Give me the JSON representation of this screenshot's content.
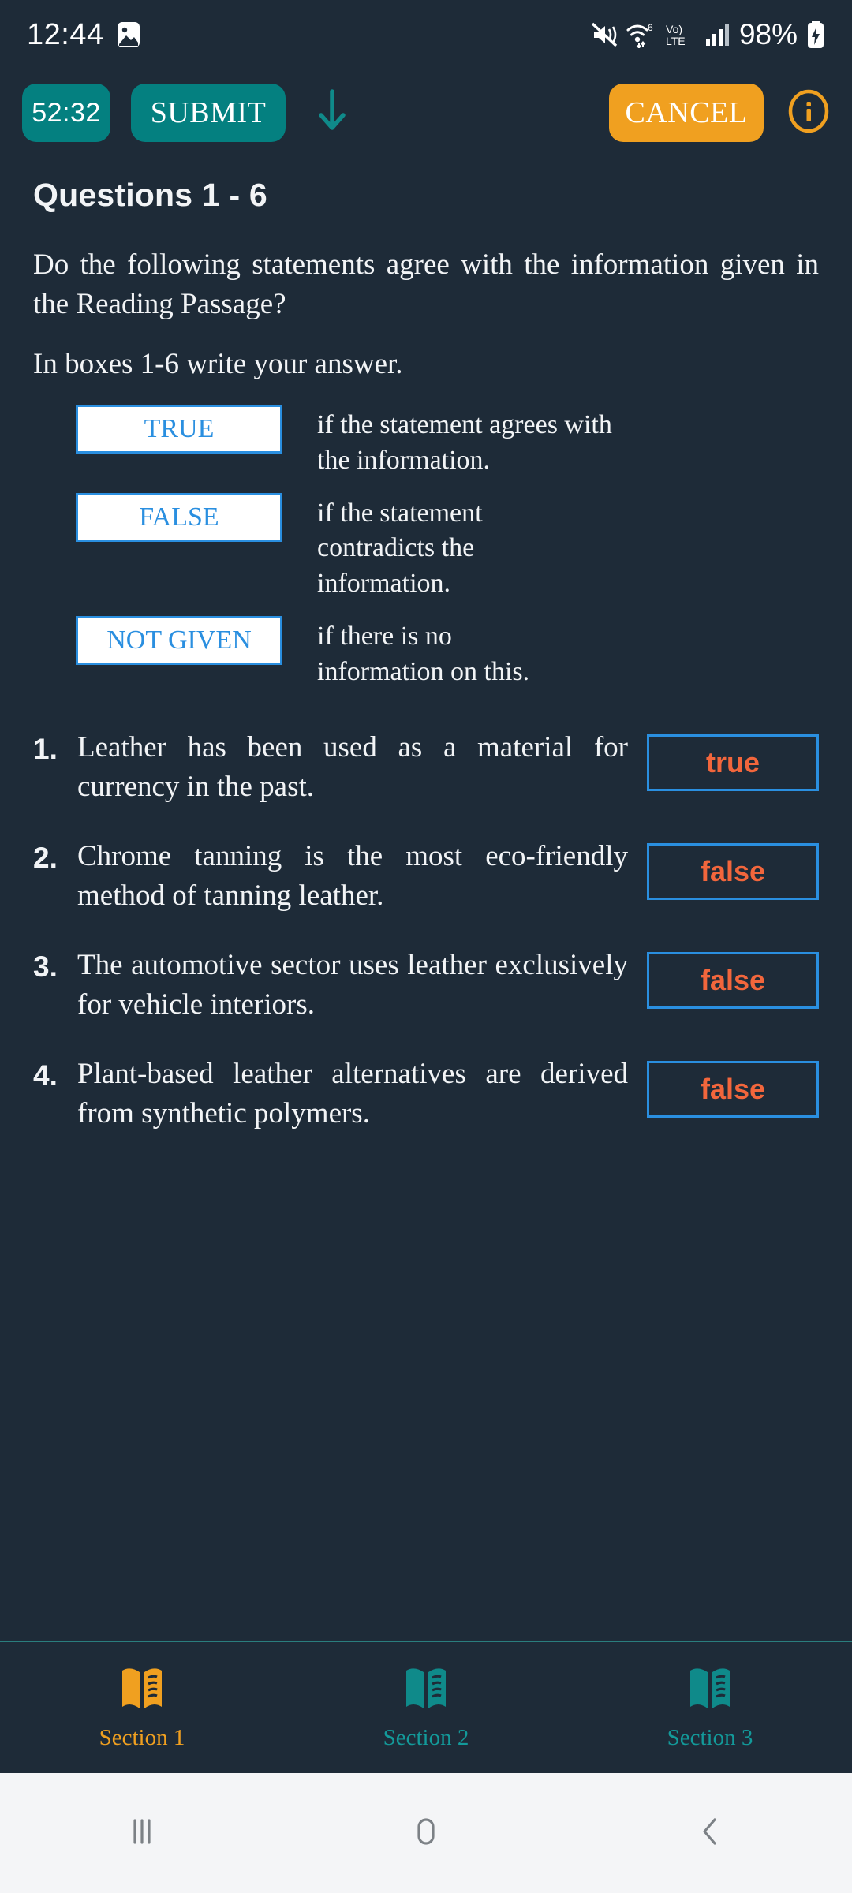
{
  "statusbar": {
    "time": "12:44",
    "battery_percent": "98%",
    "icons": [
      "image-icon",
      "mute-icon",
      "wifi6-icon",
      "volte-lte-icon",
      "signal-bars-icon",
      "battery-charging-icon"
    ]
  },
  "toolbar": {
    "timer": "52:32",
    "submit_label": "SUBMIT",
    "cancel_label": "CANCEL",
    "scroll_down_icon": "arrow-down-icon",
    "info_icon": "info-circle-icon",
    "colors": {
      "teal": "#048080",
      "orange": "#f0a020"
    }
  },
  "content": {
    "heading": "Questions 1 - 6",
    "intro": "Do the following statements agree with the information given in the Reading Passage?",
    "instruction": "In boxes 1-6 write your answer.",
    "legend": [
      {
        "label": "TRUE",
        "desc": "if the statement agrees with the information."
      },
      {
        "label": "FALSE",
        "desc": "if the statement contradicts the information."
      },
      {
        "label": "NOT GIVEN",
        "desc": "if there is no information on this."
      }
    ],
    "questions": [
      {
        "num": "1.",
        "text": "Leather has been used as a material for currency in the past.",
        "answer": "true"
      },
      {
        "num": "2.",
        "text": "Chrome tanning is the most eco-friendly method of tanning leather.",
        "answer": "false"
      },
      {
        "num": "3.",
        "text": "The automotive sector uses leather exclusively for vehicle interiors.",
        "answer": "false"
      },
      {
        "num": "4.",
        "text": "Plant-based leather alternatives are derived from synthetic polymers.",
        "answer": "false"
      }
    ]
  },
  "bottomnav": {
    "items": [
      {
        "label": "Section 1",
        "icon": "book-icon",
        "active": true
      },
      {
        "label": "Section 2",
        "icon": "book-icon",
        "active": false
      },
      {
        "label": "Section 3",
        "icon": "book-icon",
        "active": false
      }
    ]
  },
  "sysnav": {
    "recents": "recents-icon",
    "home": "home-icon",
    "back": "back-icon"
  },
  "colors": {
    "background": "#1e2b38",
    "accent_blue": "#2a8fe0",
    "answer_text": "#f2663c",
    "teal": "#048080",
    "orange": "#f0a020"
  }
}
